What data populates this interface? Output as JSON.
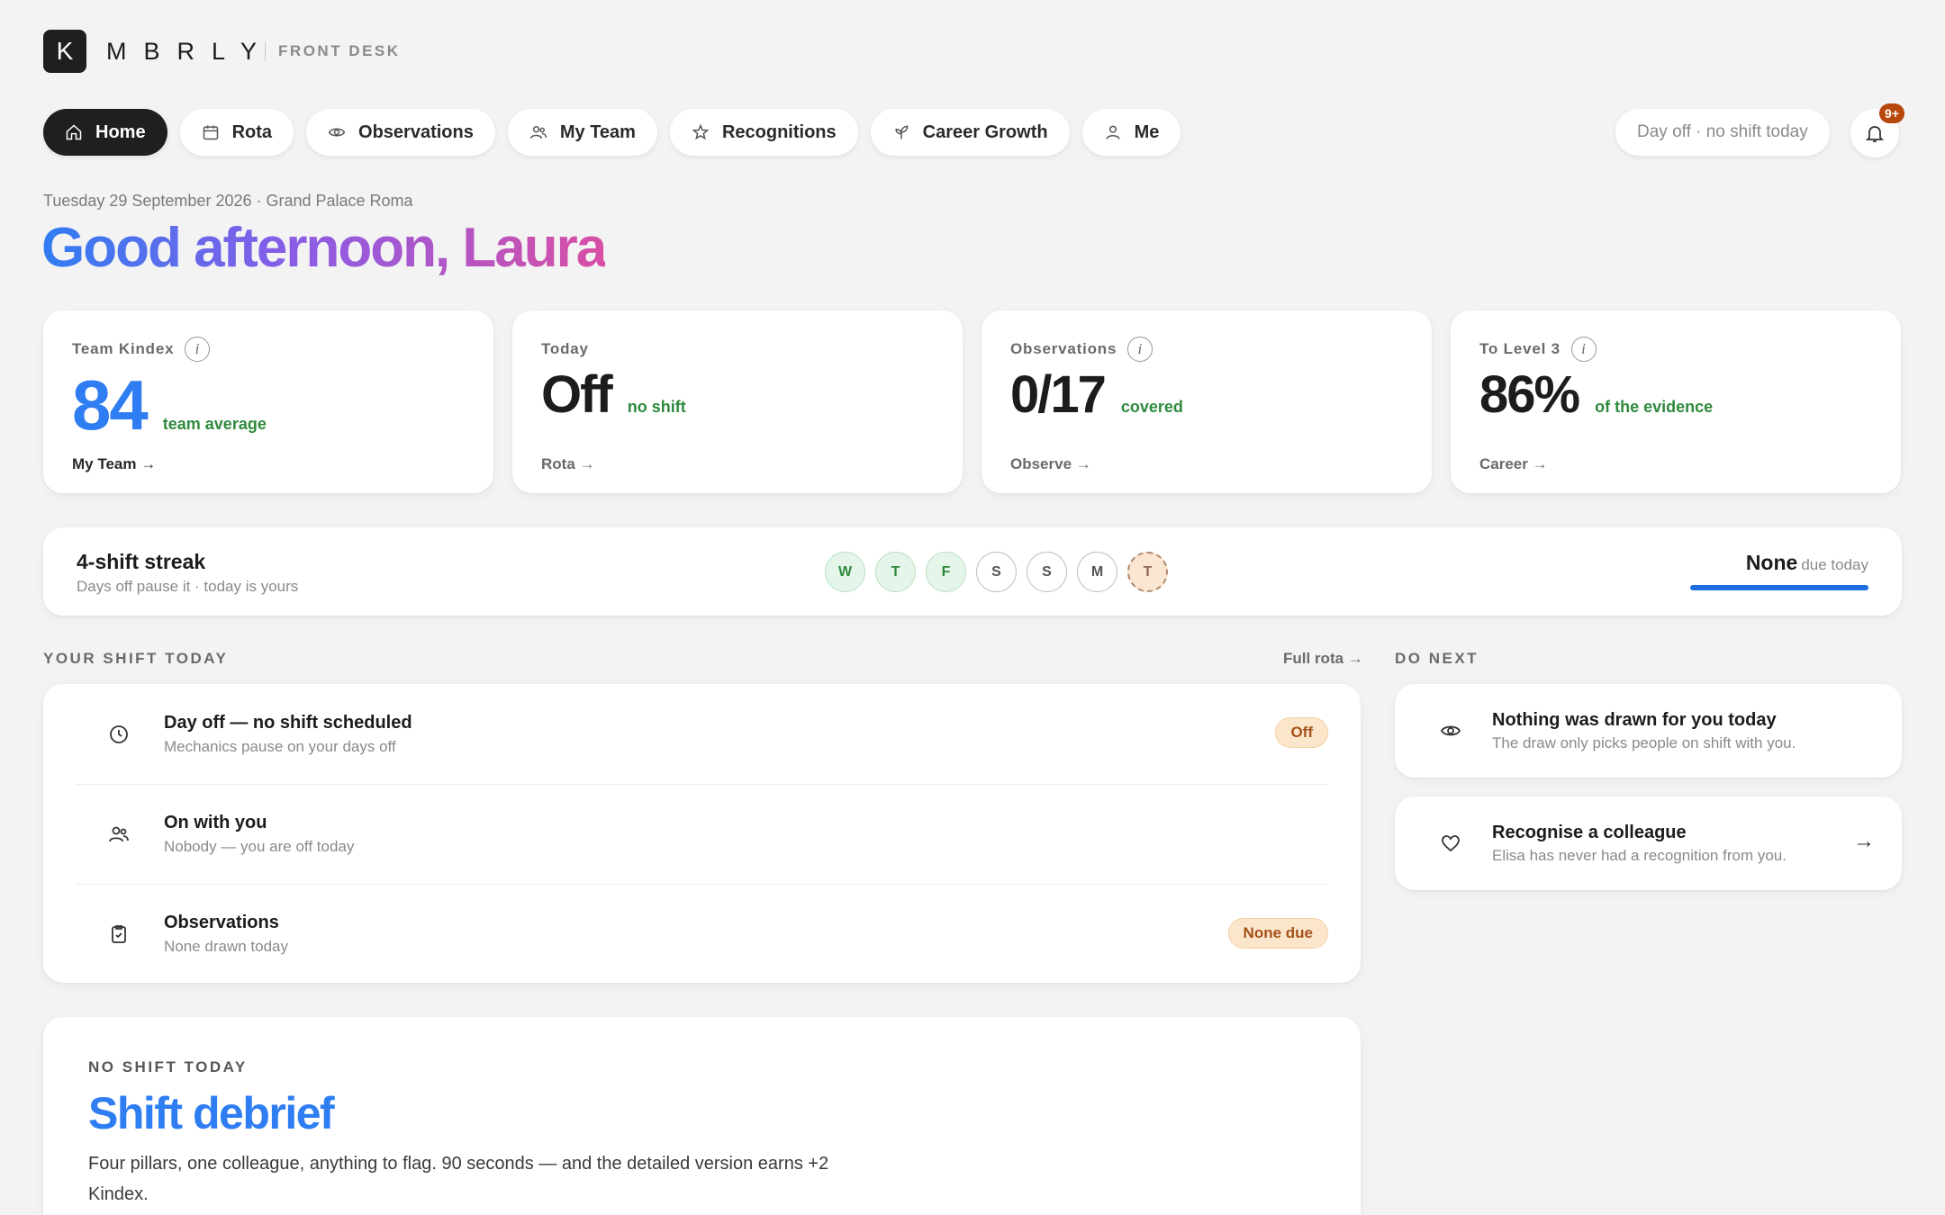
{
  "brand": {
    "logo_letter": "K",
    "name": "MBRLY",
    "sub": "FRONT DESK"
  },
  "nav": {
    "items": [
      {
        "label": "Home",
        "icon": "home-icon"
      },
      {
        "label": "Rota",
        "icon": "calendar-icon"
      },
      {
        "label": "Observations",
        "icon": "eye-icon"
      },
      {
        "label": "My Team",
        "icon": "users-icon"
      },
      {
        "label": "Recognitions",
        "icon": "star-icon"
      },
      {
        "label": "Career Growth",
        "icon": "sprout-icon"
      },
      {
        "label": "Me",
        "icon": "user-icon"
      }
    ],
    "active": "Home"
  },
  "header": {
    "status_pill": "Day off · no shift today",
    "notifications_badge": "9+"
  },
  "greeting": {
    "date_line": "Tuesday 29 September 2026 · Grand Palace Roma",
    "text": "Good afternoon, Laura"
  },
  "stats": [
    {
      "label": "Team Kindex",
      "value": "84",
      "note": "team average",
      "link": "My Team →"
    },
    {
      "label": "Today",
      "value": "Off",
      "note": "no shift",
      "link": "Rota →"
    },
    {
      "label": "Observations",
      "value": "0/17",
      "note": "covered",
      "link": "Observe →"
    },
    {
      "label": "To Level 3",
      "value": "86%",
      "note": "of the evidence",
      "link": "Career →"
    }
  ],
  "streak": {
    "title": "4-shift streak",
    "subtitle": "Days off pause it · today is yours",
    "days": [
      {
        "letter": "W",
        "state": "done"
      },
      {
        "letter": "T",
        "state": "done"
      },
      {
        "letter": "F",
        "state": "done"
      },
      {
        "letter": "S",
        "state": "empty"
      },
      {
        "letter": "S",
        "state": "empty"
      },
      {
        "letter": "M",
        "state": "empty"
      },
      {
        "letter": "T",
        "state": "today"
      }
    ],
    "due_main": "None",
    "due_sub": "due today"
  },
  "shift_today": {
    "heading": "YOUR SHIFT TODAY",
    "link": "Full rota →",
    "rows": [
      {
        "title": "Day off — no shift scheduled",
        "subtitle": "Mechanics pause on your days off",
        "tag": "Off",
        "icon": "clock-icon"
      },
      {
        "title": "On with you",
        "subtitle": "Nobody — you are off today",
        "tag": "",
        "icon": "users-icon"
      },
      {
        "title": "Observations",
        "subtitle": "None drawn today",
        "tag": "None due",
        "icon": "clipboard-check-icon"
      }
    ]
  },
  "do_next": {
    "heading": "DO NEXT",
    "items": [
      {
        "title": "Nothing was drawn for you today",
        "subtitle": "The draw only picks people on shift with you.",
        "icon": "eye-icon"
      },
      {
        "title": "Recognise a colleague",
        "subtitle": "Elisa has never had a recognition from you.",
        "icon": "heart-icon",
        "arrow": "→"
      }
    ]
  },
  "debrief": {
    "eyebrow": "NO SHIFT TODAY",
    "title": "Shift debrief",
    "text": "Four pillars, one colleague, anything to flag. 90 seconds — and the detailed version earns +2 Kindex."
  },
  "colors": {
    "accent_blue": "#2f7df2",
    "success_green": "#2e8a3c",
    "warning_tag": "#a5521a",
    "badge": "#b8470c"
  }
}
